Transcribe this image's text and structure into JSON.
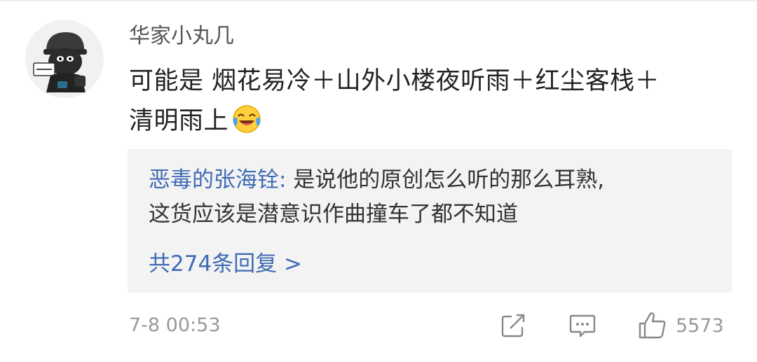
{
  "comment": {
    "username": "华家小丸几",
    "text_line1": "可能是 烟花易冷＋山外小楼夜听雨＋红尘客栈＋",
    "text_line2": "清明雨上",
    "emoji_icon": "laughing-crying-emoji-icon",
    "timestamp": "7-8 00:53",
    "like_count": "5573"
  },
  "reply_preview": {
    "author": "恶毒的张海铨",
    "separator": ": ",
    "text_line1": "是说他的原创怎么听的那么耳熟,",
    "text_line2": "这货应该是潜意识作曲撞车了都不知道",
    "more_replies": "共274条回复 >"
  },
  "icons": {
    "share": "share-icon",
    "comment": "comment-icon",
    "like": "thumbs-up-icon"
  },
  "colors": {
    "link_blue": "#3f6bb5",
    "meta_gray": "#999999",
    "reply_bg": "#f3f3f3",
    "username_gray": "#555555"
  }
}
